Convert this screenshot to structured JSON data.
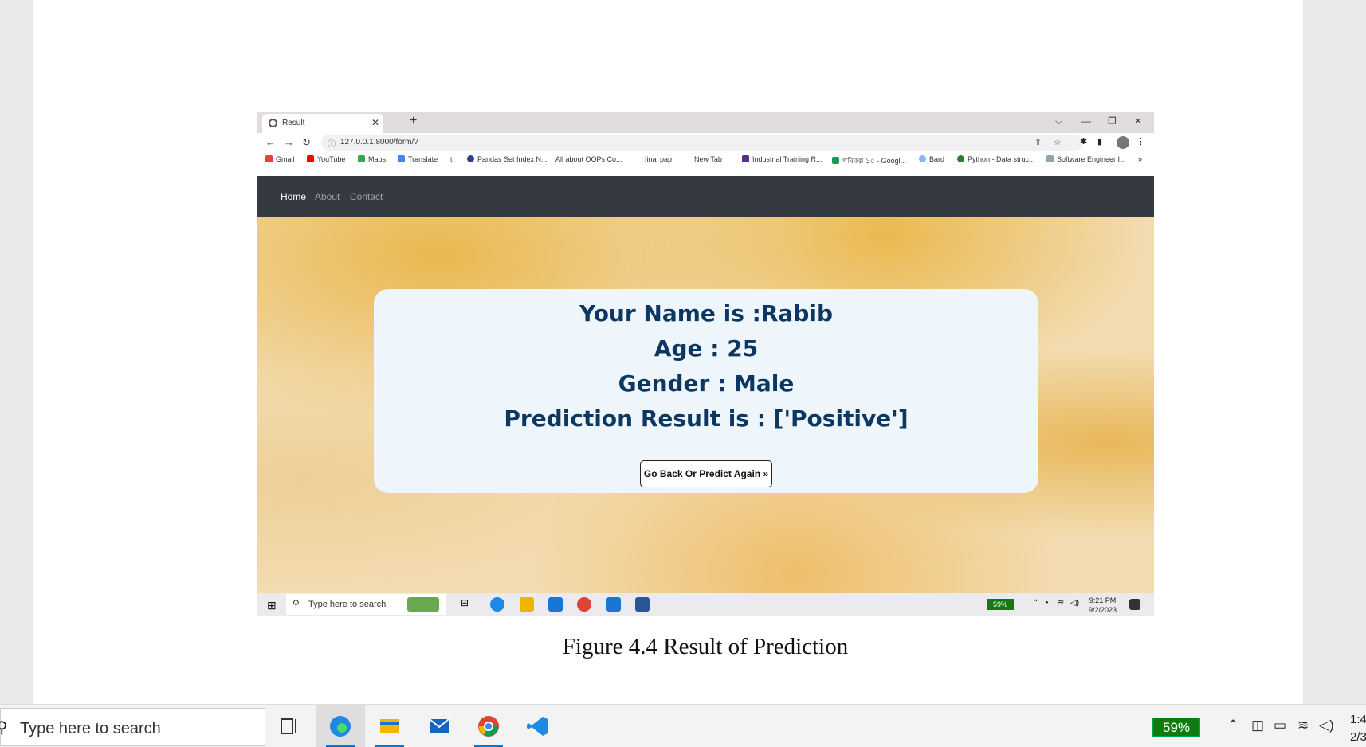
{
  "browser": {
    "tab_title": "Result",
    "url": "127.0.0.1:8000/form/?",
    "bookmarks": [
      {
        "label": "Gmail",
        "color": "#ea4335"
      },
      {
        "label": "YouTube",
        "color": "#ff0000"
      },
      {
        "label": "Maps",
        "color": "#34a853"
      },
      {
        "label": "Translate",
        "color": "#4285f4"
      },
      {
        "label": "t",
        "color": "#ffffff"
      },
      {
        "label": "Pandas Set Index N...",
        "color": "#2c3e91"
      },
      {
        "label": "All about OOPs Co...",
        "color": "#ffffff"
      },
      {
        "label": "final pap",
        "color": "#ffffff"
      },
      {
        "label": "New Tab",
        "color": "#ffffff"
      },
      {
        "label": "Industrial Training R...",
        "color": "#5c2d91"
      },
      {
        "label": "পৰিকল্প ১৫ - Googl...",
        "color": "#0f9d58"
      },
      {
        "label": "Bard",
        "color": "#8ab4f8"
      },
      {
        "label": "Python - Data struc...",
        "color": "#2e7d32"
      },
      {
        "label": "Software Engineer I...",
        "color": "#90a4ae"
      }
    ]
  },
  "site": {
    "nav": [
      "Home",
      "About",
      "Contact"
    ],
    "result": {
      "name_line": "Your Name is :Rabib",
      "age_line": "Age : 25",
      "gender_line": "Gender : Male",
      "prediction_line": "Prediction Result is : ['Positive']",
      "button_label": "Go Back Or Predict Again »"
    }
  },
  "inner_taskbar": {
    "search_placeholder": "Type here to search",
    "battery": "59%",
    "time": "9:21 PM",
    "date": "9/2/2023"
  },
  "caption": "Figure 4.4 Result of Prediction",
  "taskbar": {
    "search_placeholder": "Type here to search",
    "battery": "59%",
    "time_partial": "1:4",
    "date_partial": "2/3"
  }
}
